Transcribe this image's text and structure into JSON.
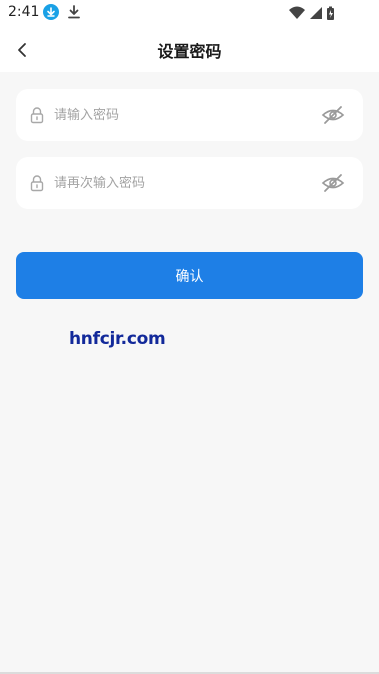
{
  "status_bar": {
    "time": "2:41",
    "icons": [
      "download-badge-icon",
      "download-icon",
      "wifi-icon",
      "signal-icon",
      "battery-icon"
    ]
  },
  "header": {
    "title": "设置密码",
    "back_icon": "chevron-left-icon"
  },
  "form": {
    "password": {
      "placeholder": "请输入密码",
      "value": "",
      "lock_icon": "lock-icon",
      "toggle_icon": "eye-off-icon"
    },
    "password_confirm": {
      "placeholder": "请再次输入密码",
      "value": "",
      "lock_icon": "lock-icon",
      "toggle_icon": "eye-off-icon"
    },
    "submit_label": "确认"
  },
  "watermark": {
    "text": "hnfcjr.com"
  },
  "colors": {
    "primary": "#1e7fe6",
    "background": "#f7f7f7",
    "card": "#ffffff",
    "placeholder": "#a3a3a3",
    "watermark": "#12299a",
    "download_badge": "#1aa1e6"
  }
}
